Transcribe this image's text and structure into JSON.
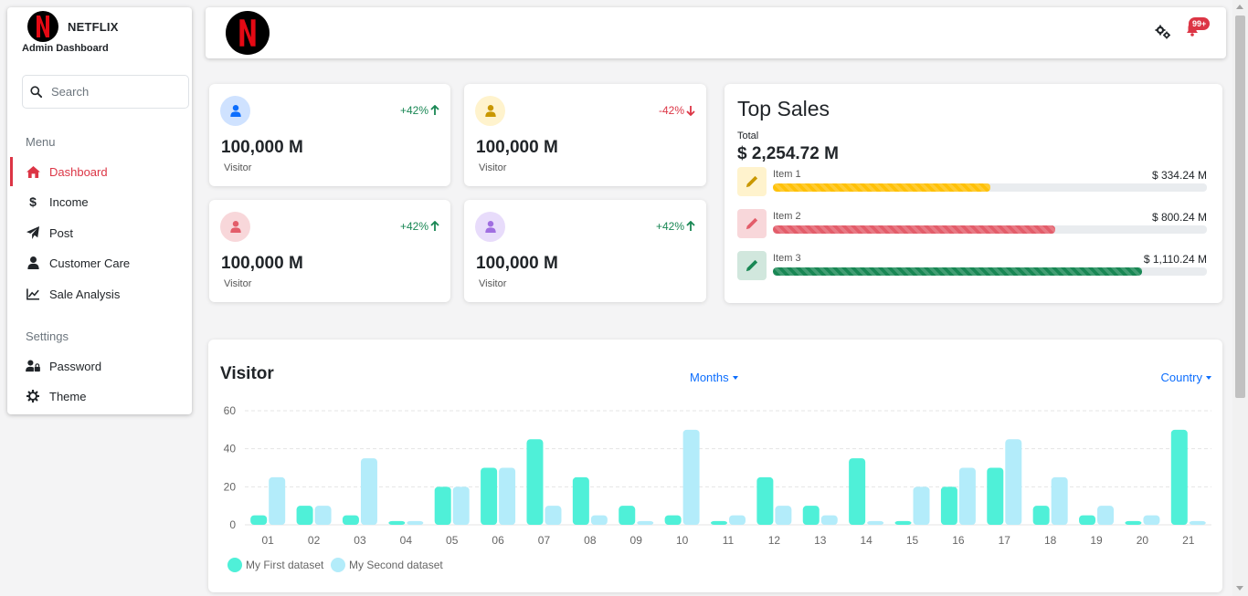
{
  "brand": {
    "name": "NETFLIX",
    "subtitle": "Admin Dashboard",
    "logo_letter": "N"
  },
  "search": {
    "placeholder": "Search",
    "value": ""
  },
  "sidebar": {
    "menu_label": "Menu",
    "settings_label": "Settings",
    "menu_items": [
      {
        "label": "Dashboard",
        "icon": "home-icon",
        "active": true
      },
      {
        "label": "Income",
        "icon": "dollar-icon"
      },
      {
        "label": "Post",
        "icon": "paper-plane-icon"
      },
      {
        "label": "Customer Care",
        "icon": "user-icon"
      },
      {
        "label": "Sale Analysis",
        "icon": "line-chart-icon"
      }
    ],
    "settings_items": [
      {
        "label": "Password",
        "icon": "user-lock-icon"
      },
      {
        "label": "Theme",
        "icon": "cog-icon"
      }
    ]
  },
  "topbar": {
    "notification_count": "99+"
  },
  "stats": [
    {
      "value": "100,000 M",
      "label": "Visitor",
      "change": "+42%",
      "direction": "up",
      "icon_color": "#0d6efd",
      "bg": "#cfe2ff"
    },
    {
      "value": "100,000 M",
      "label": "Visitor",
      "change": "-42%",
      "direction": "down",
      "icon_color": "#c99700",
      "bg": "#fff3cd"
    },
    {
      "value": "100,000 M",
      "label": "Visitor",
      "change": "+42%",
      "direction": "up",
      "icon_color": "#e35d6a",
      "bg": "#f8d7da"
    },
    {
      "value": "100,000 M",
      "label": "Visitor",
      "change": "+42%",
      "direction": "up",
      "icon_color": "#a06ee1",
      "bg": "#e8dcfb"
    }
  ],
  "colors": {
    "up": "#198754",
    "down": "#dc3545",
    "accent": "#dc3545",
    "link": "#0d6efd"
  },
  "top_sales": {
    "title": "Top Sales",
    "total_label": "Total",
    "total": "$ 2,254.72 M",
    "items": [
      {
        "name": "Item 1",
        "amount": "$ 334.24 M",
        "progress": 0.5,
        "color": "#ffc107",
        "bg": "#fff3cd"
      },
      {
        "name": "Item 2",
        "amount": "$ 800.24 M",
        "progress": 0.65,
        "color": "#e35d6a",
        "bg": "#f8d7da"
      },
      {
        "name": "Item 3",
        "amount": "$ 1,110.24 M",
        "progress": 0.85,
        "color": "#198754",
        "bg": "#d1e7dd"
      }
    ]
  },
  "visitor": {
    "title": "Visitor",
    "months_label": "Months",
    "country_label": "Country"
  },
  "chart_data": {
    "type": "bar",
    "categories": [
      "01",
      "02",
      "03",
      "04",
      "05",
      "06",
      "07",
      "08",
      "09",
      "10",
      "11",
      "12",
      "13",
      "14",
      "15",
      "16",
      "17",
      "18",
      "19",
      "20",
      "21"
    ],
    "series": [
      {
        "name": "My First dataset",
        "color": "#4ff0d8",
        "values": [
          5,
          10,
          5,
          2,
          20,
          30,
          45,
          25,
          10,
          5,
          2,
          25,
          10,
          35,
          2,
          20,
          30,
          10,
          5,
          2,
          50
        ]
      },
      {
        "name": "My Second dataset",
        "color": "#b3ecfa",
        "values": [
          25,
          10,
          35,
          2,
          20,
          30,
          10,
          5,
          2,
          50,
          5,
          10,
          5,
          2,
          20,
          30,
          45,
          25,
          10,
          5,
          2
        ]
      }
    ],
    "ylim": [
      0,
      60
    ],
    "yticks": [
      "0",
      "20",
      "40",
      "60"
    ],
    "grid": true,
    "legend": "bottom-left"
  }
}
